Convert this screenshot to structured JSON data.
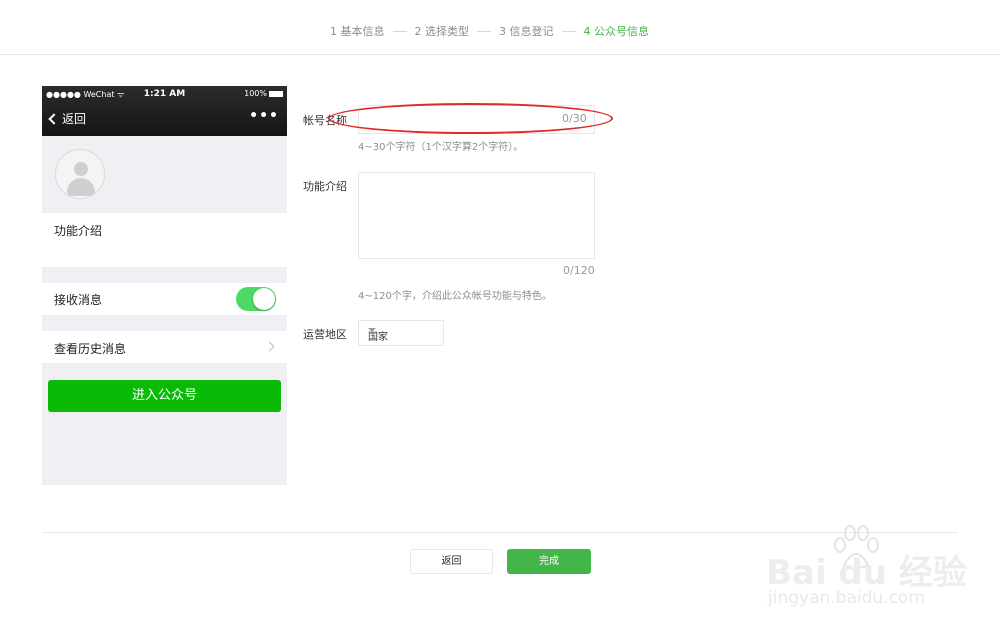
{
  "stepper": {
    "steps": [
      {
        "label": "1 基本信息"
      },
      {
        "label": "2 选择类型"
      },
      {
        "label": "3 信息登记"
      },
      {
        "label": "4 公众号信息"
      }
    ]
  },
  "phone": {
    "status": {
      "carrier": "●●●●● WeChat ᯤ",
      "time": "1:21 AM",
      "battery": "100%"
    },
    "nav": {
      "back_label": "返回",
      "more": "•••"
    },
    "intro_label": "功能介绍",
    "receive_label": "接收消息",
    "receive_enabled": true,
    "history_label": "查看历史消息",
    "enter_button": "进入公众号"
  },
  "form": {
    "account_name": {
      "label": "帐号名称",
      "value": "",
      "counter": "0/30",
      "hint": "4~30个字符（1个汉字算2个字符）。"
    },
    "description": {
      "label": "功能介绍",
      "value": "",
      "counter": "0/120",
      "hint": "4~120个字，介绍此公众帐号功能与特色。"
    },
    "region": {
      "label": "运营地区",
      "selected": "国家"
    }
  },
  "footer": {
    "back_button": "返回",
    "done_button": "完成"
  },
  "watermark": {
    "brand": "Bai du 经验",
    "url": "jingyan.baidu.com"
  },
  "colors": {
    "accent": "#44b549",
    "enter_green": "#09bb07",
    "toggle_on": "#4cd964",
    "annotation": "#e02a2a"
  }
}
